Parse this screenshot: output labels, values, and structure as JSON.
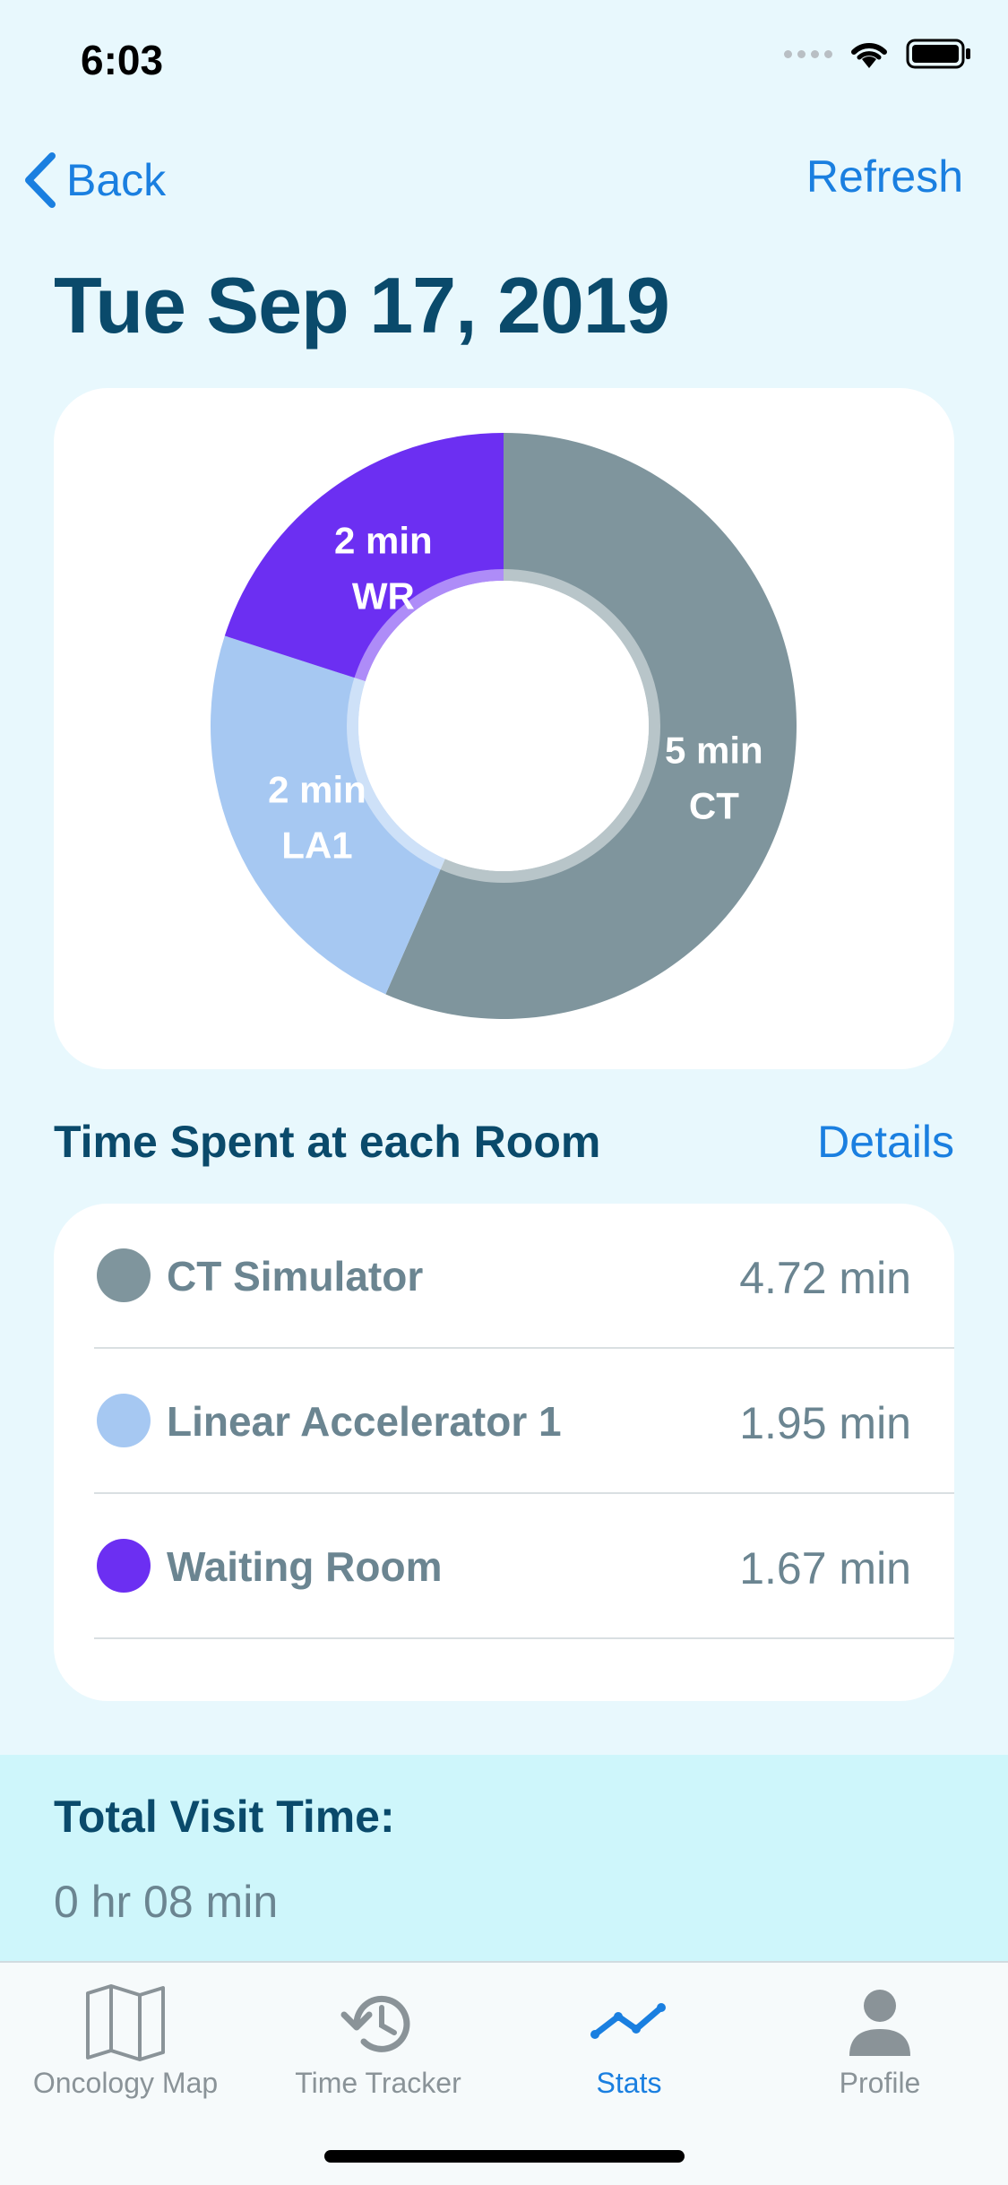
{
  "status_bar": {
    "time": "6:03"
  },
  "nav": {
    "back_label": "Back",
    "refresh_label": "Refresh"
  },
  "page_title": "Tue Sep 17, 2019",
  "chart_data": {
    "type": "pie",
    "categories": [
      "CT",
      "LA1",
      "WR"
    ],
    "values": [
      4.72,
      1.95,
      1.67
    ],
    "slice_labels": [
      {
        "value": "5 min",
        "name": "CT"
      },
      {
        "value": "2 min",
        "name": "LA1"
      },
      {
        "value": "2 min",
        "name": "WR"
      }
    ],
    "colors": [
      "#7f959d",
      "#a6c8f2",
      "#6c2ff2"
    ]
  },
  "section": {
    "title": "Time Spent at each Room",
    "details_label": "Details"
  },
  "rooms": [
    {
      "name": "CT Simulator",
      "value": "4.72 min",
      "color": "#7f959d"
    },
    {
      "name": "Linear Accelerator 1",
      "value": "1.95 min",
      "color": "#a6c8f2"
    },
    {
      "name": "Waiting Room",
      "value": "1.67 min",
      "color": "#6c2ff2"
    }
  ],
  "total": {
    "label": "Total Visit Time:",
    "value": "0 hr 08 min"
  },
  "tabs": [
    {
      "label": "Oncology Map",
      "icon": "map-icon",
      "active": false
    },
    {
      "label": "Time Tracker",
      "icon": "history-icon",
      "active": false
    },
    {
      "label": "Stats",
      "icon": "stats-icon",
      "active": true
    },
    {
      "label": "Profile",
      "icon": "person-icon",
      "active": false
    }
  ],
  "colors": {
    "accent": "#1a7fe0",
    "title": "#0a4a6b",
    "muted": "#6b8591"
  }
}
